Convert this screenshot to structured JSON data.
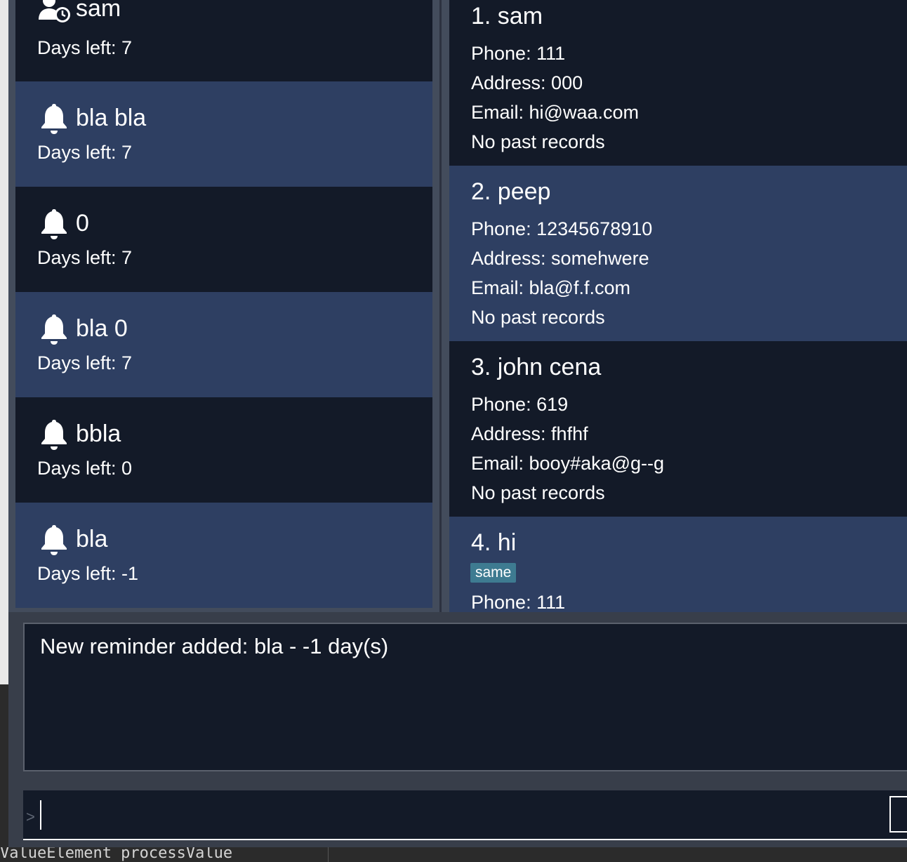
{
  "reminders": [
    {
      "title": "sam",
      "days": "Days left: 7",
      "icon": "user-clock-icon"
    },
    {
      "title": "bla bla",
      "days": "Days left: 7",
      "icon": "bell-icon"
    },
    {
      "title": "0",
      "days": "Days left: 7",
      "icon": "bell-icon"
    },
    {
      "title": "bla 0",
      "days": "Days left: 7",
      "icon": "bell-icon"
    },
    {
      "title": "bbla",
      "days": "Days left: 0",
      "icon": "bell-icon"
    },
    {
      "title": "bla",
      "days": "Days left: -1",
      "icon": "bell-icon"
    }
  ],
  "persons": [
    {
      "name": "1.  sam",
      "phone": "Phone: 111",
      "address": "Address: 000",
      "email": "Email: hi@waa.com",
      "records": "No past records"
    },
    {
      "name": "2.  peep",
      "phone": "Phone: 12345678910",
      "address": "Address: somehwere",
      "email": "Email: bla@f.f.com",
      "records": "No past records"
    },
    {
      "name": "3.  john cena",
      "phone": "Phone: 619",
      "address": "Address: fhfhf",
      "email": "Email: booy#aka@g--g",
      "records": "No past records"
    },
    {
      "name": "4.  hi",
      "tag": "same",
      "phone": "Phone: 111"
    }
  ],
  "result_display": {
    "text": "New reminder added: bla - -1 day(s)"
  },
  "command_box": {
    "prompt": ">",
    "value": ""
  },
  "background_fragments": {
    "bottom_text": "ValueElement processValue"
  },
  "colors": {
    "card_dark": "#131a28",
    "card_light": "#2e3f62",
    "tag": "#3e7b91",
    "frame": "#434c5c"
  }
}
